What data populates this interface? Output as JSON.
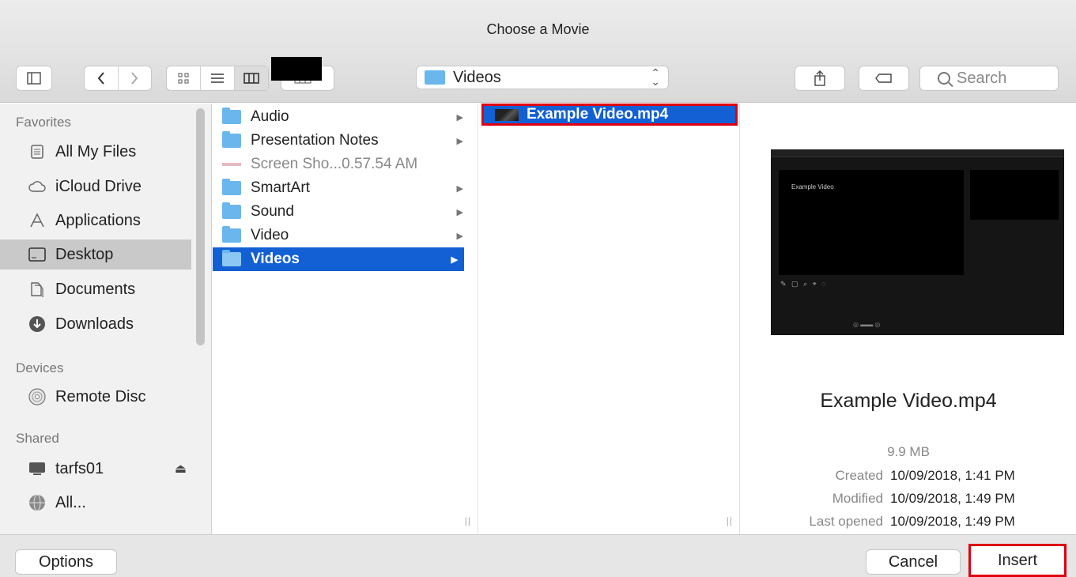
{
  "window": {
    "title": "Choose a Movie"
  },
  "toolbar": {
    "path_label": "Videos",
    "search_placeholder": "Search"
  },
  "sidebar": {
    "sections": {
      "favorites": "Favorites",
      "devices": "Devices",
      "shared": "Shared"
    },
    "favorites": [
      {
        "label": "All My Files",
        "icon": "all-files-icon"
      },
      {
        "label": "iCloud Drive",
        "icon": "cloud-icon"
      },
      {
        "label": "Applications",
        "icon": "applications-icon"
      },
      {
        "label": "Desktop",
        "icon": "desktop-icon",
        "selected": true
      },
      {
        "label": "Documents",
        "icon": "documents-icon"
      },
      {
        "label": "Downloads",
        "icon": "downloads-icon"
      }
    ],
    "devices": [
      {
        "label": "Remote Disc",
        "icon": "disc-icon"
      }
    ],
    "shared": [
      {
        "label": "tarfs01",
        "icon": "server-icon"
      },
      {
        "label": "All...",
        "icon": "network-icon"
      }
    ]
  },
  "column1": {
    "items": [
      {
        "label": "Audio",
        "type": "folder"
      },
      {
        "label": "Presentation Notes",
        "type": "folder"
      },
      {
        "label": "Screen Sho...0.57.54 AM",
        "type": "file"
      },
      {
        "label": "SmartArt",
        "type": "folder"
      },
      {
        "label": "Sound",
        "type": "folder"
      },
      {
        "label": "Video",
        "type": "folder"
      },
      {
        "label": "Videos",
        "type": "folder",
        "selected": true
      }
    ]
  },
  "column2": {
    "items": [
      {
        "label": "Example Video.mp4",
        "selected": true
      }
    ]
  },
  "preview": {
    "thumbnail_text": "Example Video",
    "name": "Example Video.mp4",
    "size": "9.9 MB",
    "meta": [
      {
        "key": "Created",
        "value": "10/09/2018, 1:41 PM"
      },
      {
        "key": "Modified",
        "value": "10/09/2018, 1:49 PM"
      },
      {
        "key": "Last opened",
        "value": "10/09/2018, 1:49 PM"
      }
    ]
  },
  "buttons": {
    "options": "Options",
    "cancel": "Cancel",
    "insert": "Insert"
  },
  "colors": {
    "selection": "#1360d4",
    "folder": "#6ab7ee",
    "highlight_box": "#e00010"
  }
}
